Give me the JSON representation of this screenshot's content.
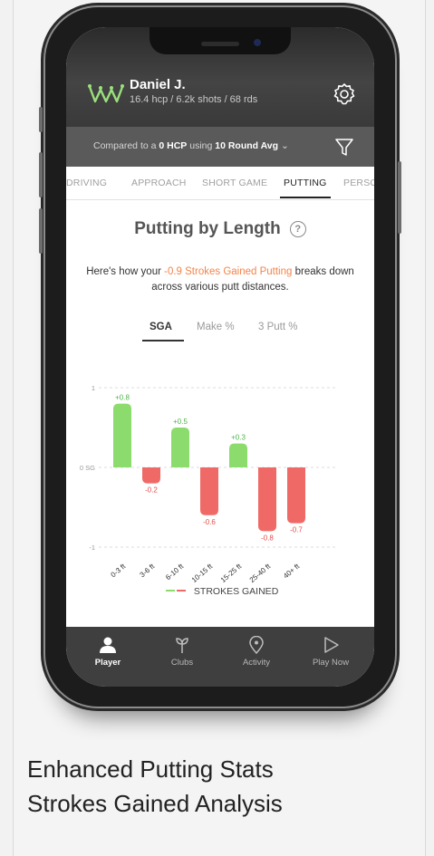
{
  "user": {
    "name": "Daniel J.",
    "stats": "16.4 hcp / 6.2k shots / 68 rds"
  },
  "compare": {
    "prefix": "Compared to a ",
    "hcp": "0 HCP",
    "mid": " using ",
    "avg": "10 Round Avg"
  },
  "tabs": [
    "DRIVING",
    "APPROACH",
    "SHORT GAME",
    "PUTTING",
    "PERSO"
  ],
  "active_tab": "PUTTING",
  "panel": {
    "title": "Putting by Length",
    "help": "?",
    "desc_prefix": "Here's how your ",
    "desc_highlight": "-0.9 Strokes Gained Putting",
    "desc_suffix": " breaks down across various putt distances."
  },
  "segments": [
    "SGA",
    "Make %",
    "3 Putt %"
  ],
  "active_segment": "SGA",
  "chart_data": {
    "type": "bar",
    "categories": [
      "0-3 ft",
      "3-6 ft",
      "6-10 ft",
      "10-15 ft",
      "15-25 ft",
      "25-40 ft",
      "40+ ft"
    ],
    "values": [
      0.8,
      -0.2,
      0.5,
      -0.6,
      0.3,
      -0.8,
      -0.7
    ],
    "labels": [
      "+0.8",
      "-0.2",
      "+0.5",
      "-0.6",
      "+0.3",
      "-0.8",
      "-0.7"
    ],
    "yticks": [
      "1",
      "0 SG",
      "-1"
    ],
    "ylim": [
      -1,
      1
    ],
    "legend": "STROKES GAINED",
    "positive_color": "#8bdc6c",
    "negative_color": "#ef6a66",
    "grid": true
  },
  "tabbar": [
    {
      "label": "Player",
      "icon": "player-icon",
      "active": true
    },
    {
      "label": "Clubs",
      "icon": "clubs-icon",
      "active": false
    },
    {
      "label": "Activity",
      "icon": "activity-icon",
      "active": false
    },
    {
      "label": "Play Now",
      "icon": "play-icon",
      "active": false
    }
  ],
  "caption": {
    "line1": "Enhanced Putting Stats",
    "line2": "Strokes Gained Analysis"
  }
}
